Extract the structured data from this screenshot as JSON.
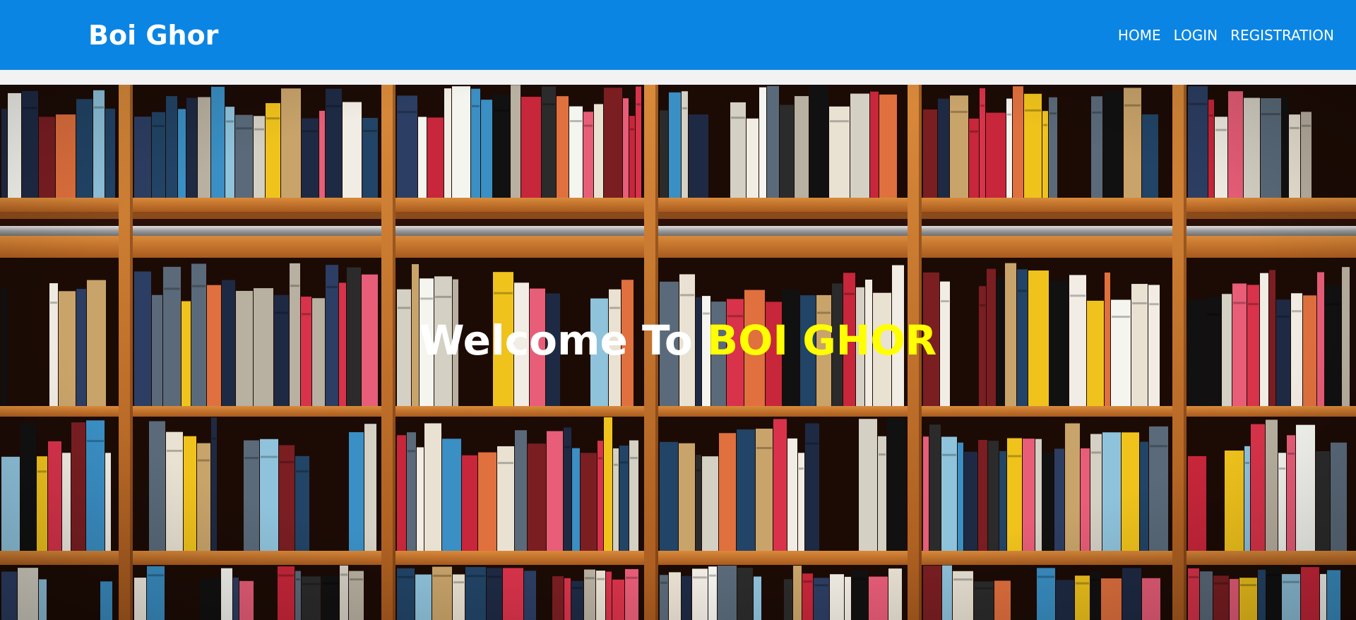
{
  "header": {
    "brand": "Boi Ghor",
    "nav": [
      {
        "label": "HOME"
      },
      {
        "label": "LOGIN"
      },
      {
        "label": "REGISTRATION"
      }
    ]
  },
  "hero": {
    "welcome_prefix": "Welcome To",
    "welcome_brand": "BOI GHOR",
    "image": "bookshelf-photo"
  },
  "colors": {
    "navbar": "#0a85e3",
    "nav_text": "#ffffff",
    "heading_white": "#ffffff",
    "heading_yellow": "#ffff00",
    "page_background": "#f2f2f2"
  }
}
